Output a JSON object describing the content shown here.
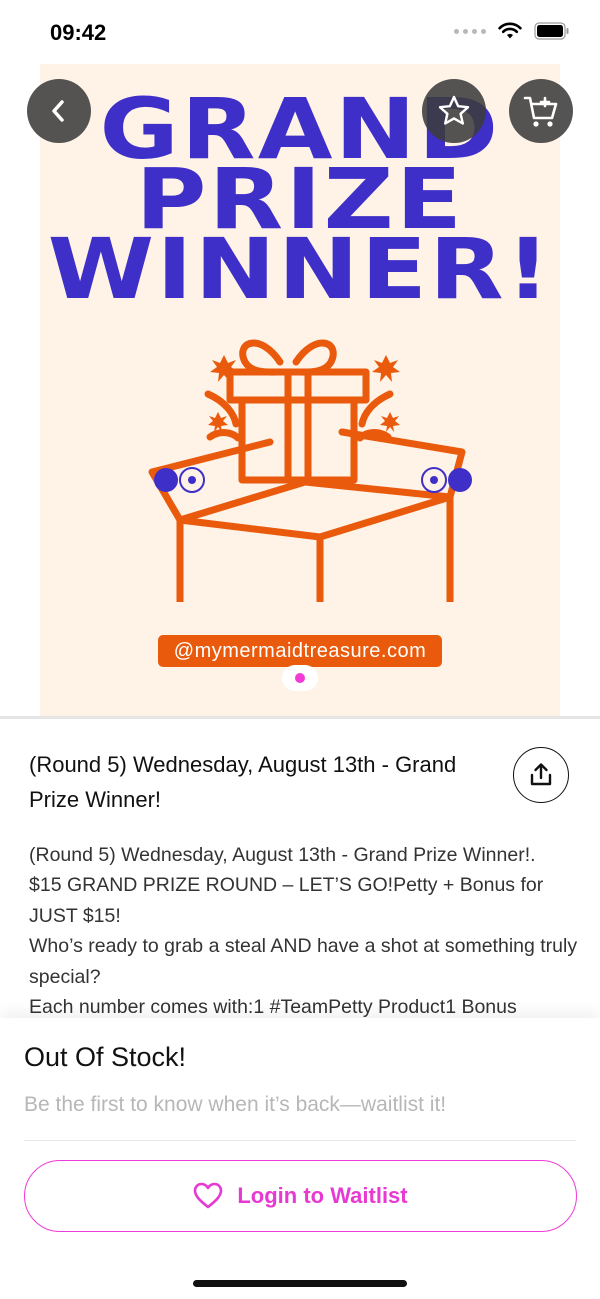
{
  "status_bar": {
    "time": "09:42"
  },
  "hero": {
    "headline_lines": [
      "GRAND",
      "PRIZE",
      "WINNER!"
    ],
    "handle": "@mymermaidtreasure.com",
    "slide_index": 1,
    "slide_count": 1
  },
  "product": {
    "title": "(Round 5) Wednesday, August 13th - Grand Prize Winner!",
    "description_lines": [
      "(Round 5) Wednesday, August 13th - Grand Prize Winner!.",
      "$15 GRAND PRIZE ROUND – LET’S GO!Petty + Bonus for JUST $15!",
      "Who’s ready to grab a steal AND have a shot at something truly special?",
      "Each number comes with:1 #TeamPetty Product1 Bonus"
    ]
  },
  "waitlist": {
    "status_title": "Out Of Stock!",
    "status_subtitle": "Be the first to know when it’s back—waitlist it!",
    "button_label": "Login to Waitlist"
  },
  "icons": {
    "back": "chevron-left-icon",
    "favorite": "star-icon",
    "cart": "cart-icon",
    "share": "share-icon",
    "waitlist": "heart-icon"
  },
  "colors": {
    "headline": "#3f2fc9",
    "gift": "#ea5a0c",
    "poster_bg": "#fef3e6",
    "accent_pink": "#e63ad3",
    "overlay_button": "#3c3c3c"
  }
}
